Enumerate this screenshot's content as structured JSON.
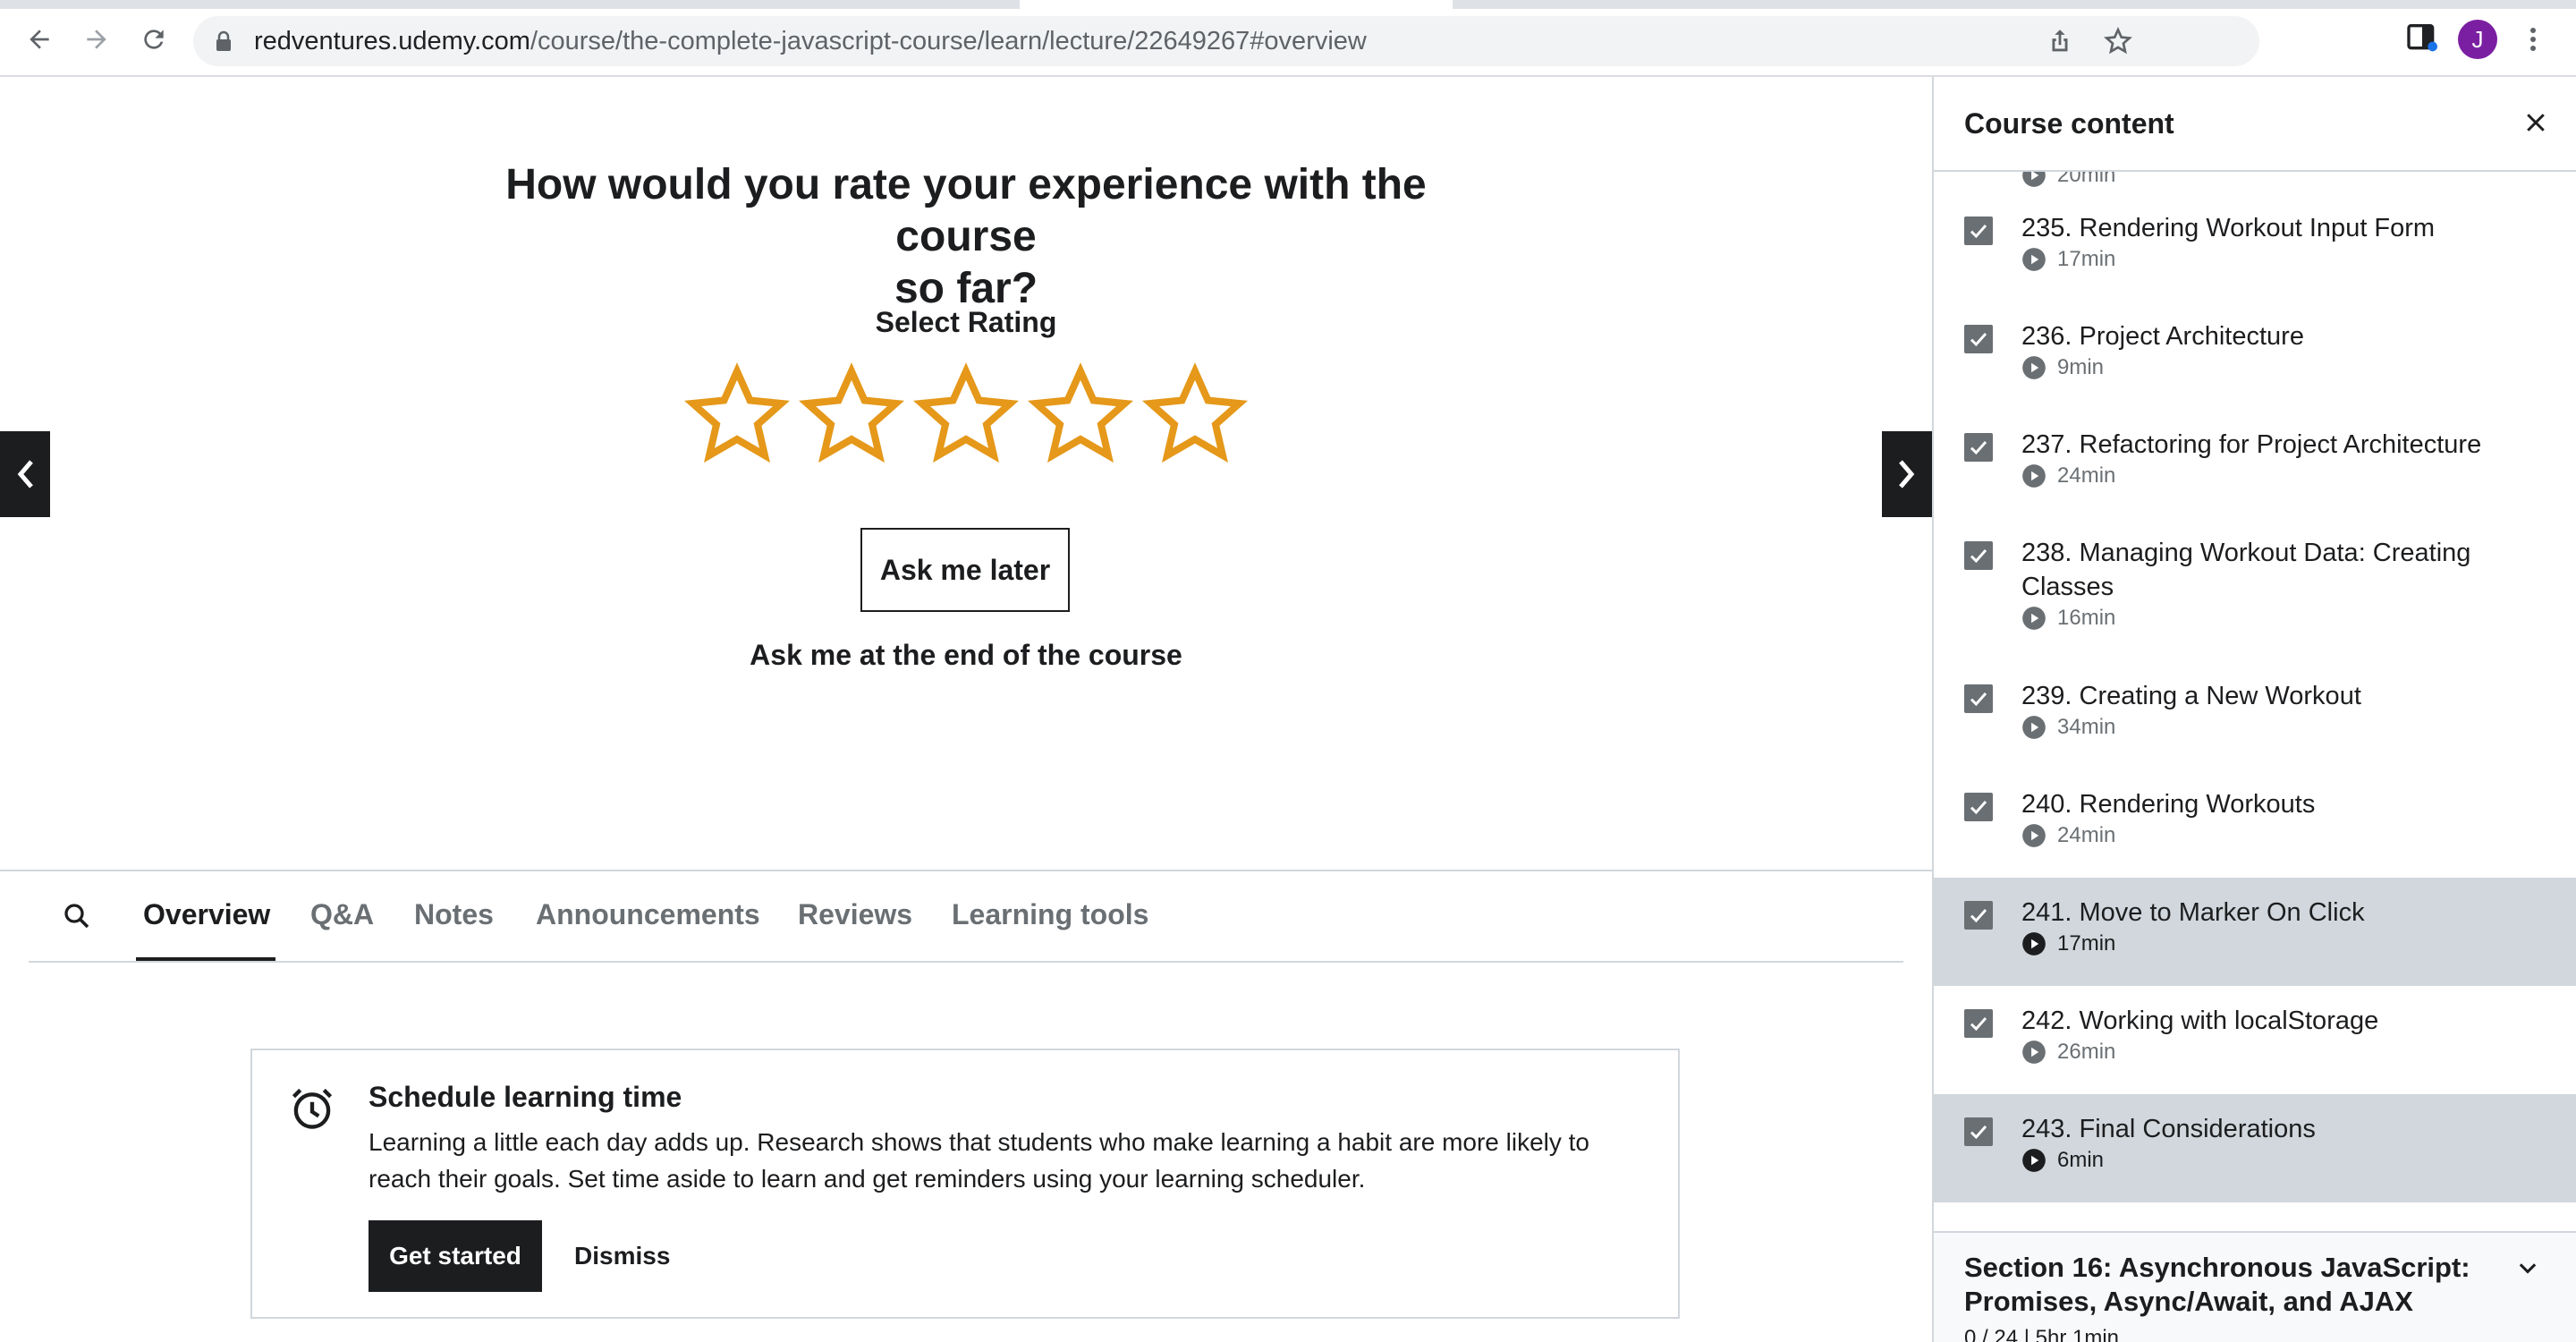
{
  "browser": {
    "url_host": "redventures.udemy.com",
    "url_path": "/course/the-complete-javascript-course/learn/lecture/22649267#overview",
    "profile_initial": "J"
  },
  "rating": {
    "title_line1": "How would you rate your experience with the course",
    "title_line2": "so far?",
    "select_label": "Select Rating",
    "stars_selected": 0,
    "stars_total": 5,
    "star_color": "#e59819",
    "ask_later": "Ask me later",
    "ask_end": "Ask me at the end of the course"
  },
  "tabs": [
    {
      "label": "Overview",
      "active": true
    },
    {
      "label": "Q&A"
    },
    {
      "label": "Notes"
    },
    {
      "label": "Announcements"
    },
    {
      "label": "Reviews"
    },
    {
      "label": "Learning tools"
    }
  ],
  "schedule": {
    "title": "Schedule learning time",
    "body": "Learning a little each day adds up. Research shows that students who make learning a habit are more likely to reach their goals. Set time aside to learn and get reminders using your learning scheduler.",
    "primary": "Get started",
    "secondary": "Dismiss"
  },
  "sidebar": {
    "title": "Course content",
    "partial_duration": "20min",
    "lectures": [
      {
        "title": "235. Rendering Workout Input Form",
        "duration": "17min",
        "done": true
      },
      {
        "title": "236. Project Architecture",
        "duration": "9min",
        "done": true
      },
      {
        "title": "237. Refactoring for Project Architecture",
        "duration": "24min",
        "done": true
      },
      {
        "title": "238. Managing Workout Data: Creating Classes",
        "duration": "16min",
        "done": true
      },
      {
        "title": "239. Creating a New Workout",
        "duration": "34min",
        "done": true
      },
      {
        "title": "240. Rendering Workouts",
        "duration": "24min",
        "done": true
      },
      {
        "title": "241. Move to Marker On Click",
        "duration": "17min",
        "done": true,
        "current": true
      },
      {
        "title": "242. Working with localStorage",
        "duration": "26min",
        "done": true
      },
      {
        "title": "243. Final Considerations",
        "duration": "6min",
        "done": true,
        "current": true
      }
    ],
    "section": {
      "title": "Section 16: Asynchronous JavaScript: Promises, Async/Await, and AJAX",
      "meta": "0 / 24 | 5hr 1min"
    }
  },
  "colors": {
    "text": "#1c1d1f",
    "muted": "#6a6f73",
    "border": "#d1d7dc",
    "highlight": "#d1d7dc",
    "avatar": "#7b1fa2"
  }
}
